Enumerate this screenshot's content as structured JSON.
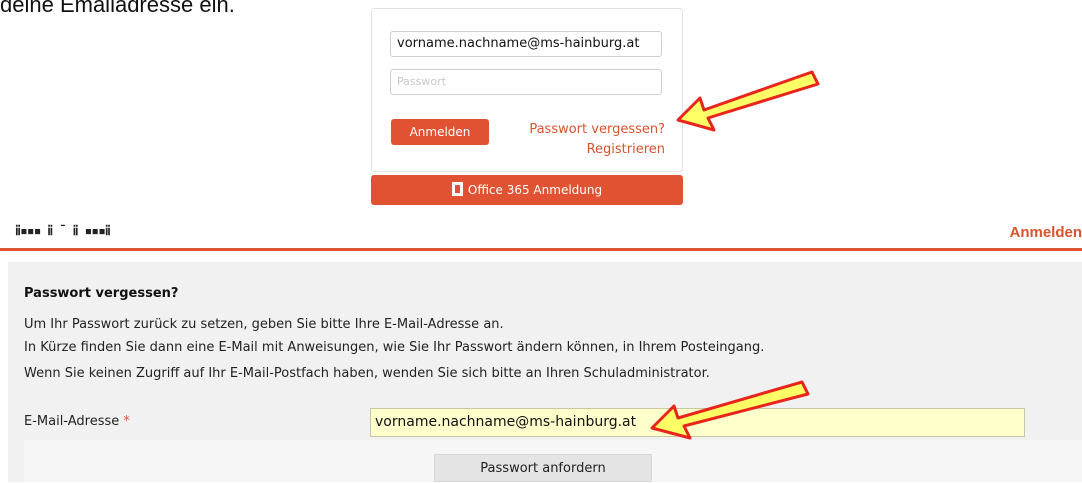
{
  "intro": {
    "text": "deine Emailadresse ein."
  },
  "login": {
    "email_value": "vorname.nachname@ms-hainburg.at",
    "password_placeholder": "Passwort",
    "login_button": "Anmelden",
    "forgot_link": "Passwort vergessen?",
    "register_link": "Registrieren",
    "office_button": "Office 365 Anmeldung"
  },
  "header": {
    "logo_text": "ⅱ▪▪▪ ⅱ ˉ ⅱ ▪▪▪ⅱ",
    "nav_login": "Anmelden",
    "accent_color": "#e05231"
  },
  "reset": {
    "title": "Passwort vergessen?",
    "line1": "Um Ihr Passwort zurück zu setzen, geben Sie bitte Ihre E-Mail-Adresse an.",
    "line2": "In Kürze finden Sie dann eine E-Mail mit Anweisungen, wie Sie Ihr Passwort ändern können, in Ihrem Posteingang.",
    "line3": "Wenn Sie keinen Zugriff auf Ihr E-Mail-Postfach haben, wenden Sie sich bitte an Ihren Schuladministrator.",
    "email_label": "E-Mail-Adresse",
    "required_mark": "*",
    "email_value": "vorname.nachname@ms-hainburg.at",
    "submit_button": "Passwort anfordern"
  },
  "annotations": {
    "arrow_color": "#ffff66",
    "arrow_outline": "#e8241c"
  }
}
